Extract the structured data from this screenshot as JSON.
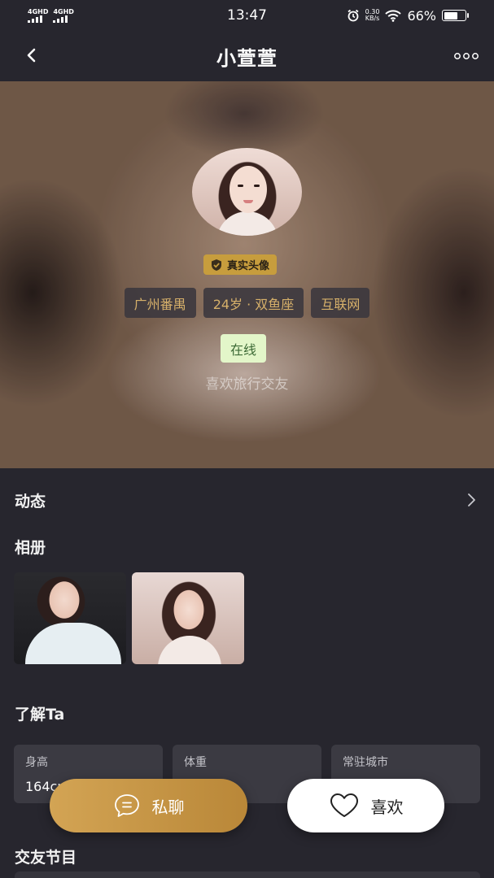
{
  "status_bar": {
    "network_left": "4GHD",
    "network_right": "4GHD",
    "time": "13:47",
    "speed_value": "0.30",
    "speed_unit": "KB/s",
    "battery_percent": "66%",
    "battery_level": 0.66
  },
  "nav": {
    "title": "小萱萱",
    "back_icon": "chevron-left-icon",
    "more_icon": "more-dots-icon"
  },
  "profile": {
    "real_avatar_badge": "真实头像",
    "tags": [
      "广州番禺",
      "24岁 · 双鱼座",
      "互联网"
    ],
    "online_status": "在线",
    "bio": "喜欢旅行交友"
  },
  "sections": {
    "moments": "动态",
    "album": "相册",
    "about": "了解Ta",
    "programs": "交友节目"
  },
  "about_cards": [
    {
      "label": "身高",
      "value": "164cm"
    },
    {
      "label": "体重",
      "value": ""
    },
    {
      "label": "常驻城市",
      "value": ""
    }
  ],
  "actions": {
    "chat_label": "私聊",
    "like_label": "喜欢"
  },
  "colors": {
    "background": "#27262e",
    "accent_gold": "#c79d3d",
    "tag_text": "#d6b06a",
    "online_bg": "#e3f6c9"
  }
}
